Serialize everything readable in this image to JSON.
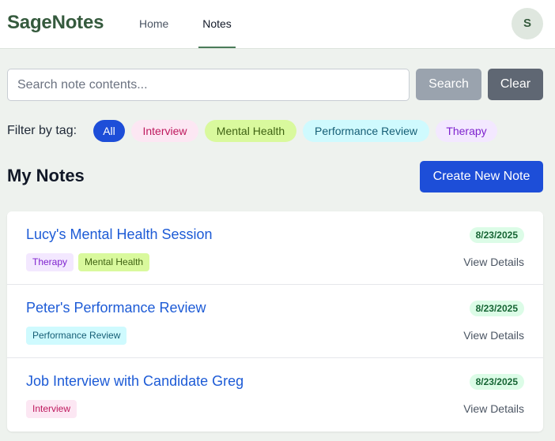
{
  "header": {
    "brand": "SageNotes",
    "nav": {
      "home": "Home",
      "notes": "Notes"
    },
    "avatar_initial": "S"
  },
  "search": {
    "placeholder": "Search note contents...",
    "value": "",
    "search_label": "Search",
    "clear_label": "Clear"
  },
  "filter": {
    "label": "Filter by tag:",
    "tags": [
      "All",
      "Interview",
      "Mental Health",
      "Performance Review",
      "Therapy"
    ],
    "selected": "All"
  },
  "notes_section": {
    "title": "My Notes",
    "create_label": "Create New Note"
  },
  "notes": [
    {
      "title": "Lucy's Mental Health Session",
      "tags": [
        "Therapy",
        "Mental Health"
      ],
      "date": "8/23/2025",
      "view_label": "View Details"
    },
    {
      "title": "Peter's Performance Review",
      "tags": [
        "Performance Review"
      ],
      "date": "8/23/2025",
      "view_label": "View Details"
    },
    {
      "title": "Job Interview with Candidate Greg",
      "tags": [
        "Interview"
      ],
      "date": "8/23/2025",
      "view_label": "View Details"
    }
  ],
  "colors": {
    "brand": "#355a3d",
    "primary": "#1d4ed8",
    "background": "#eef2ee"
  }
}
